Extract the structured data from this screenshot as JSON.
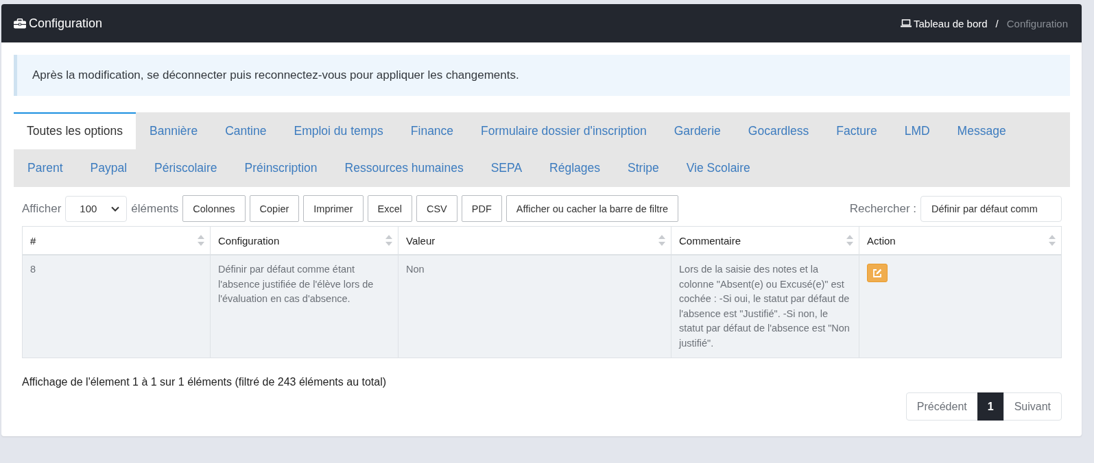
{
  "header": {
    "title": "Configuration",
    "breadcrumb": [
      {
        "label": "Tableau de bord",
        "kind": "link"
      },
      {
        "label": "/",
        "kind": "separator"
      },
      {
        "label": "Configuration",
        "kind": "current"
      }
    ]
  },
  "alert": "Après la modification, se déconnecter puis reconnectez-vous pour appliquer les changements.",
  "tabs": [
    {
      "label": "Toutes les options",
      "selected": true
    },
    {
      "label": "Bannière",
      "selected": false
    },
    {
      "label": "Cantine",
      "selected": false
    },
    {
      "label": "Emploi du temps",
      "selected": false
    },
    {
      "label": "Finance",
      "selected": false
    },
    {
      "label": "Formulaire dossier d'inscription",
      "selected": false
    },
    {
      "label": "Garderie",
      "selected": false
    },
    {
      "label": "Gocardless",
      "selected": false
    },
    {
      "label": "Facture",
      "selected": false
    },
    {
      "label": "LMD",
      "selected": false
    },
    {
      "label": "Message",
      "selected": false
    },
    {
      "label": "Parent",
      "selected": false
    },
    {
      "label": "Paypal",
      "selected": false
    },
    {
      "label": "Périscolaire",
      "selected": false
    },
    {
      "label": "Préinscription",
      "selected": false
    },
    {
      "label": "Ressources humaines",
      "selected": false
    },
    {
      "label": "SEPA",
      "selected": false
    },
    {
      "label": "Réglages",
      "selected": false
    },
    {
      "label": "Stripe",
      "selected": false
    },
    {
      "label": "Vie Scolaire",
      "selected": false
    }
  ],
  "toolbar": {
    "show_label": "Afficher",
    "page_size": "100",
    "elements_label": "éléments",
    "buttons": [
      "Colonnes",
      "Copier",
      "Imprimer",
      "Excel",
      "CSV",
      "PDF",
      "Afficher ou cacher la barre de filtre"
    ],
    "search_label": "Rechercher :",
    "search_value": "Définir par défaut comm"
  },
  "table": {
    "columns": [
      "#",
      "Configuration",
      "Valeur",
      "Commentaire",
      "Action"
    ],
    "rows": [
      {
        "cells": [
          "8",
          "Définir par défaut comme étant l'absence justifiée de l'élève lors de l'évaluation en cas d'absence.",
          "Non",
          "Lors de la saisie des notes et la colonne \"Absent(e) ou Excusé(e)\" est cochée : -Si oui, le statut par défaut de l'absence est \"Justifié\". -Si non, le statut par défaut de l'absence est \"Non justifié\"."
        ]
      }
    ]
  },
  "info": "Affichage de l'élement 1 à 1 sur 1 éléments (filtré de 243 éléments au total)",
  "pagination": [
    {
      "label": "Précédent",
      "kind": "prev",
      "selected": false
    },
    {
      "label": "1",
      "kind": "page",
      "selected": true
    },
    {
      "label": "Suivant",
      "kind": "next",
      "selected": false
    }
  ]
}
